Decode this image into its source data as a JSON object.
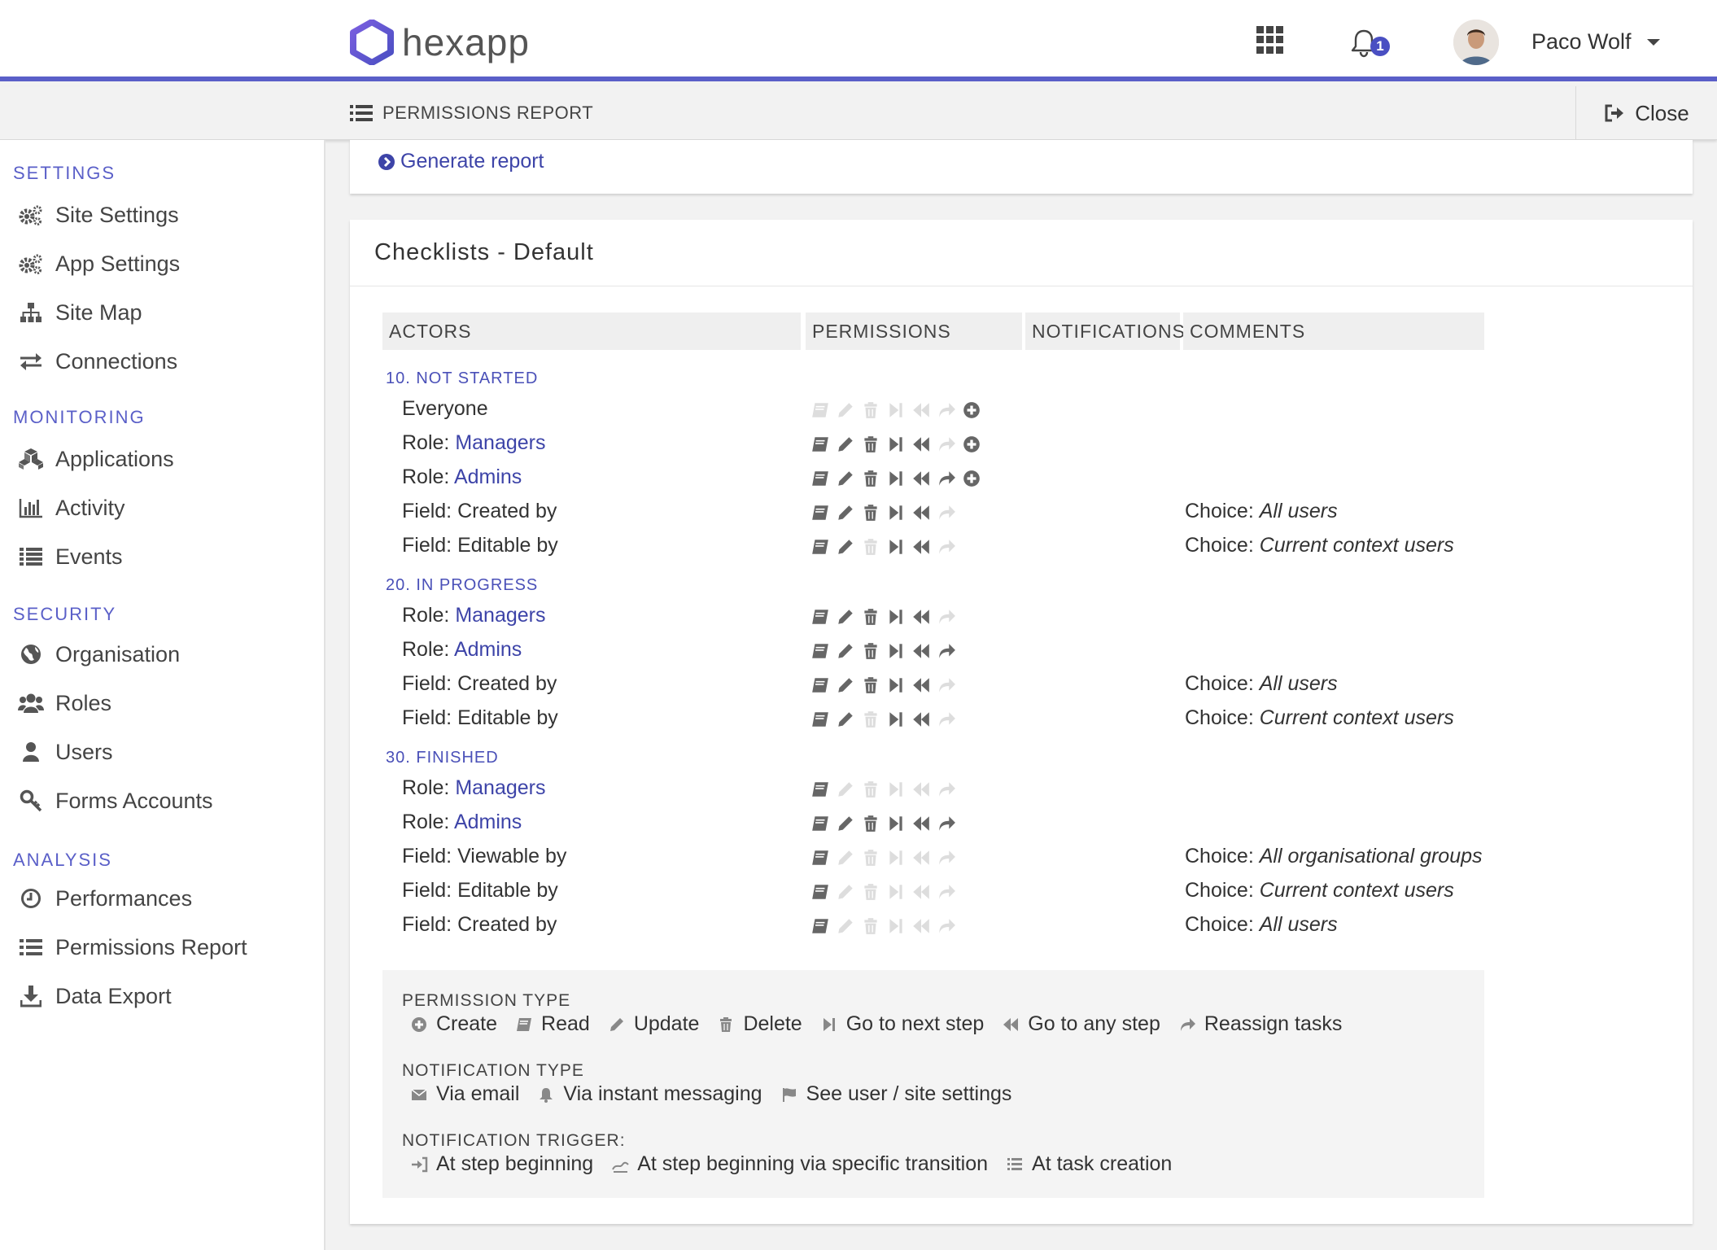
{
  "header": {
    "logo_text": "hexapp",
    "notification_count": "1",
    "user_name": "Paco Wolf",
    "brand_color": "#5a5fc8"
  },
  "subheader": {
    "title": "PERMISSIONS REPORT",
    "close_label": "Close"
  },
  "sidebar": {
    "sections": [
      {
        "title": "SETTINGS",
        "items": [
          {
            "label": "Site Settings",
            "icon": "gears-icon"
          },
          {
            "label": "App Settings",
            "icon": "gears-icon"
          },
          {
            "label": "Site Map",
            "icon": "sitemap-icon"
          },
          {
            "label": "Connections",
            "icon": "exchange-icon"
          }
        ]
      },
      {
        "title": "MONITORING",
        "items": [
          {
            "label": "Applications",
            "icon": "cubes-icon"
          },
          {
            "label": "Activity",
            "icon": "bar-chart-icon"
          },
          {
            "label": "Events",
            "icon": "list-icon"
          }
        ]
      },
      {
        "title": "SECURITY",
        "items": [
          {
            "label": "Organisation",
            "icon": "globe-icon"
          },
          {
            "label": "Roles",
            "icon": "users-icon"
          },
          {
            "label": "Users",
            "icon": "user-icon"
          },
          {
            "label": "Forms Accounts",
            "icon": "key-icon"
          }
        ]
      },
      {
        "title": "ANALYSIS",
        "items": [
          {
            "label": "Performances",
            "icon": "clock-icon"
          },
          {
            "label": "Permissions Report",
            "icon": "list-icon"
          },
          {
            "label": "Data Export",
            "icon": "download-icon"
          }
        ]
      }
    ]
  },
  "generate_report_label": "Generate report",
  "checklist": {
    "title": "Checklists - Default",
    "columns": [
      "ACTORS",
      "PERMISSIONS",
      "NOTIFICATIONS",
      "COMMENTS"
    ],
    "stages": [
      {
        "title": "10. NOT STARTED",
        "rows": [
          {
            "prefix": "Everyone",
            "role": "",
            "perms": {
              "read": false,
              "update": false,
              "delete": false,
              "next": false,
              "any": false,
              "reassign": false,
              "create": true
            },
            "comment_prefix": "",
            "comment_value": ""
          },
          {
            "prefix": "Role: ",
            "role": "Managers",
            "perms": {
              "read": true,
              "update": true,
              "delete": true,
              "next": true,
              "any": true,
              "reassign": false,
              "create": true
            },
            "comment_prefix": "",
            "comment_value": ""
          },
          {
            "prefix": "Role: ",
            "role": "Admins",
            "perms": {
              "read": true,
              "update": true,
              "delete": true,
              "next": true,
              "any": true,
              "reassign": true,
              "create": true
            },
            "comment_prefix": "",
            "comment_value": ""
          },
          {
            "prefix": "Field: Created by",
            "role": "",
            "perms": {
              "read": true,
              "update": true,
              "delete": true,
              "next": true,
              "any": true,
              "reassign": false
            },
            "comment_prefix": "Choice: ",
            "comment_value": "All users"
          },
          {
            "prefix": "Field: Editable by",
            "role": "",
            "perms": {
              "read": true,
              "update": true,
              "delete": false,
              "next": true,
              "any": true,
              "reassign": false
            },
            "comment_prefix": "Choice: ",
            "comment_value": "Current context users"
          }
        ]
      },
      {
        "title": "20. IN PROGRESS",
        "rows": [
          {
            "prefix": "Role: ",
            "role": "Managers",
            "perms": {
              "read": true,
              "update": true,
              "delete": true,
              "next": true,
              "any": true,
              "reassign": false
            },
            "comment_prefix": "",
            "comment_value": ""
          },
          {
            "prefix": "Role: ",
            "role": "Admins",
            "perms": {
              "read": true,
              "update": true,
              "delete": true,
              "next": true,
              "any": true,
              "reassign": true
            },
            "comment_prefix": "",
            "comment_value": ""
          },
          {
            "prefix": "Field: Created by",
            "role": "",
            "perms": {
              "read": true,
              "update": true,
              "delete": true,
              "next": true,
              "any": true,
              "reassign": false
            },
            "comment_prefix": "Choice: ",
            "comment_value": "All users"
          },
          {
            "prefix": "Field: Editable by",
            "role": "",
            "perms": {
              "read": true,
              "update": true,
              "delete": false,
              "next": true,
              "any": true,
              "reassign": false
            },
            "comment_prefix": "Choice: ",
            "comment_value": "Current context users"
          }
        ]
      },
      {
        "title": "30. FINISHED",
        "rows": [
          {
            "prefix": "Role: ",
            "role": "Managers",
            "perms": {
              "read": true,
              "update": false,
              "delete": false,
              "next": false,
              "any": false,
              "reassign": false
            },
            "comment_prefix": "",
            "comment_value": ""
          },
          {
            "prefix": "Role: ",
            "role": "Admins",
            "perms": {
              "read": true,
              "update": true,
              "delete": true,
              "next": true,
              "any": true,
              "reassign": true
            },
            "comment_prefix": "",
            "comment_value": ""
          },
          {
            "prefix": "Field: Viewable by",
            "role": "",
            "perms": {
              "read": true,
              "update": false,
              "delete": false,
              "next": false,
              "any": false,
              "reassign": false
            },
            "comment_prefix": "Choice: ",
            "comment_value": "All organisational groups"
          },
          {
            "prefix": "Field: Editable by",
            "role": "",
            "perms": {
              "read": true,
              "update": false,
              "delete": false,
              "next": false,
              "any": false,
              "reassign": false
            },
            "comment_prefix": "Choice: ",
            "comment_value": "Current context users"
          },
          {
            "prefix": "Field: Created by",
            "role": "",
            "perms": {
              "read": true,
              "update": false,
              "delete": false,
              "next": false,
              "any": false,
              "reassign": false
            },
            "comment_prefix": "Choice: ",
            "comment_value": "All users"
          }
        ]
      }
    ]
  },
  "legend": {
    "permission_type_title": "PERMISSION TYPE",
    "permission_types": [
      {
        "label": "Create",
        "icon": "plus-circle-icon"
      },
      {
        "label": "Read",
        "icon": "book-icon"
      },
      {
        "label": "Update",
        "icon": "pencil-icon"
      },
      {
        "label": "Delete",
        "icon": "trash-icon"
      },
      {
        "label": "Go to next step",
        "icon": "step-forward-icon"
      },
      {
        "label": "Go to any step",
        "icon": "backward-icon"
      },
      {
        "label": "Reassign tasks",
        "icon": "share-icon"
      }
    ],
    "notification_type_title": "NOTIFICATION TYPE",
    "notification_types": [
      {
        "label": "Via email",
        "icon": "envelope-icon"
      },
      {
        "label": "Via instant messaging",
        "icon": "bell-icon"
      },
      {
        "label": "See user / site settings",
        "icon": "flag-icon"
      }
    ],
    "notification_trigger_title": "NOTIFICATION TRIGGER:",
    "notification_triggers": [
      {
        "label": "At step beginning",
        "icon": "sign-in-icon"
      },
      {
        "label": "At step beginning via specific transition",
        "icon": "road-icon"
      },
      {
        "label": "At task creation",
        "icon": "tasks-icon"
      }
    ]
  },
  "colors": {
    "accent": "#5a5fc8",
    "link": "#3d44a8",
    "icon_active": "#666666",
    "icon_inactive": "#dddddd"
  }
}
